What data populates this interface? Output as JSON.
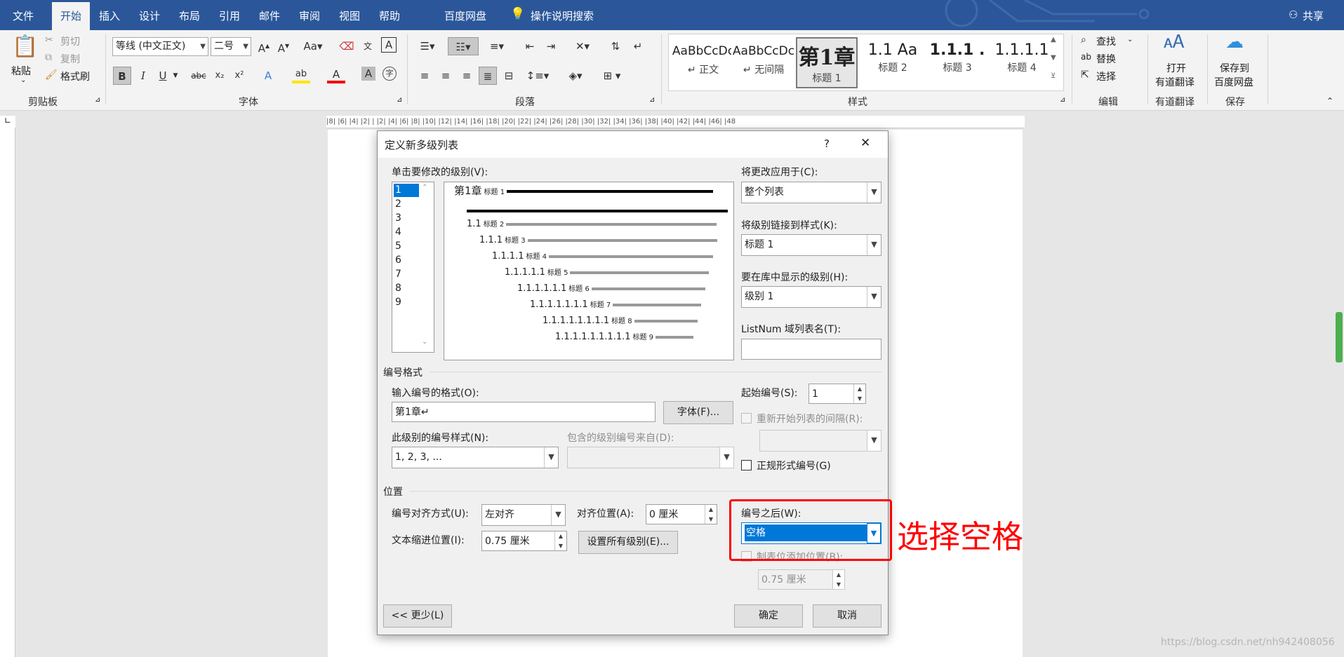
{
  "menubar": {
    "items": [
      "文件",
      "开始",
      "插入",
      "设计",
      "布局",
      "引用",
      "邮件",
      "审阅",
      "视图",
      "帮助",
      "百度网盘",
      "操作说明搜索"
    ],
    "share": "共享"
  },
  "ribbon": {
    "clipboard": {
      "paste": "粘贴",
      "cut": "剪切",
      "copy": "复制",
      "format_painter": "格式刷",
      "label": "剪贴板"
    },
    "font": {
      "name": "等线 (中文正文)",
      "size": "二号",
      "label": "字体"
    },
    "paragraph": {
      "label": "段落"
    },
    "styles": {
      "label": "样式",
      "items": [
        {
          "sample": "AaBbCcDc",
          "name": "↵ 正文"
        },
        {
          "sample": "AaBbCcDc",
          "name": "↵ 无间隔"
        },
        {
          "sample": "第1章",
          "name": "标题 1"
        },
        {
          "sample": "1.1 Aa",
          "name": "标题 2"
        },
        {
          "sample": "1.1.1 .",
          "name": "标题 3"
        },
        {
          "sample": "1.1.1.1",
          "name": "标题 4"
        }
      ]
    },
    "editing": {
      "find": "查找",
      "replace": "替换",
      "select": "选择",
      "label": "编辑"
    },
    "youdao": {
      "line1": "打开",
      "line2": "有道翻译",
      "label": "有道翻译"
    },
    "baidu": {
      "line1": "保存到",
      "line2": "百度网盘",
      "label": "保存"
    }
  },
  "ruler": {
    "ticks": "|8| |6| |4| |2| | |2| |4| |6| |8| |10| |12| |14| |16| |18| |20| |22| |24| |26| |28| |30| |32| |34| |36| |38| |40| |42| |44| |46| |48"
  },
  "dialog": {
    "title": "定义新多级列表",
    "help": "?",
    "close": "✕",
    "level_label": "单击要修改的级别(V):",
    "levels": [
      "1",
      "2",
      "3",
      "4",
      "5",
      "6",
      "7",
      "8",
      "9"
    ],
    "preview": [
      {
        "num": "第1章",
        "tag": "标题 1"
      },
      {
        "num": "1.1",
        "tag": "标题 2"
      },
      {
        "num": "1.1.1",
        "tag": "标题 3"
      },
      {
        "num": "1.1.1.1",
        "tag": "标题 4"
      },
      {
        "num": "1.1.1.1.1",
        "tag": "标题 5"
      },
      {
        "num": "1.1.1.1.1.1",
        "tag": "标题 6"
      },
      {
        "num": "1.1.1.1.1.1.1",
        "tag": "标题 7"
      },
      {
        "num": "1.1.1.1.1.1.1.1",
        "tag": "标题 8"
      },
      {
        "num": "1.1.1.1.1.1.1.1.1",
        "tag": "标题 9"
      }
    ],
    "apply_to": {
      "label": "将更改应用于(C):",
      "value": "整个列表"
    },
    "link_style": {
      "label": "将级别链接到样式(K):",
      "value": "标题 1"
    },
    "gallery_level": {
      "label": "要在库中显示的级别(H):",
      "value": "级别 1"
    },
    "listnum": {
      "label": "ListNum 域列表名(T):",
      "value": ""
    },
    "number_format_section": "编号格式",
    "format_input": {
      "label": "输入编号的格式(O):",
      "value": "第1章↵"
    },
    "font_button": "字体(F)...",
    "number_style": {
      "label": "此级别的编号样式(N):",
      "value": "1, 2, 3, ..."
    },
    "include_from": {
      "label": "包含的级别编号来自(D):",
      "value": ""
    },
    "start_at": {
      "label": "起始编号(S):",
      "value": "1"
    },
    "restart": {
      "label": "重新开始列表的间隔(R):"
    },
    "legal": {
      "label": "正规形式编号(G)"
    },
    "position_section": "位置",
    "alignment": {
      "label": "编号对齐方式(U):",
      "value": "左对齐"
    },
    "align_at": {
      "label": "对齐位置(A):",
      "value": "0 厘米"
    },
    "indent": {
      "label": "文本缩进位置(I):",
      "value": "0.75 厘米"
    },
    "set_all": "设置所有级别(E)...",
    "follow": {
      "label": "编号之后(W):",
      "value": "空格"
    },
    "tab_stop": {
      "label": "制表位添加位置(B):",
      "value": "0.75 厘米"
    },
    "less_button": "<< 更少(L)",
    "ok": "确定",
    "cancel": "取消"
  },
  "annotation": {
    "text": "选择空格",
    "color": "#ff0000"
  },
  "watermark": "https://blog.csdn.net/nh942408056"
}
